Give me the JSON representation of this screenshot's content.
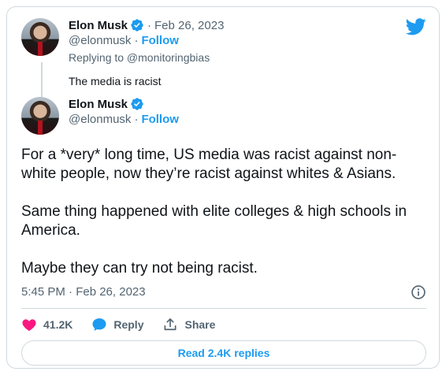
{
  "reply_to_tweet": {
    "author_name": "Elon Musk",
    "date": "Feb 26, 2023",
    "handle": "@elonmusk",
    "follow_label": "Follow",
    "replying_to": "Replying to @monitoringbias",
    "text": "The media is racist"
  },
  "main_tweet": {
    "author_name": "Elon Musk",
    "handle": "@elonmusk",
    "follow_label": "Follow",
    "paragraphs": [
      "For a *very* long time, US media was racist against non-white people, now they’re racist against whites & Asians.",
      "Same thing happened with elite colleges & high schools in America.",
      "Maybe they can try not being racist."
    ],
    "timestamp": "5:45 PM · Feb 26, 2023"
  },
  "actions": {
    "like_count": "41.2K",
    "reply_label": "Reply",
    "share_label": "Share"
  },
  "read_replies_label": "Read 2.4K replies",
  "icons": {
    "brand": "twitter-bird-icon",
    "verified": "verified-badge-icon",
    "like": "heart-icon",
    "reply": "speech-bubble-icon",
    "share": "share-icon",
    "info": "info-icon"
  },
  "colors": {
    "accent": "#1d9bf0",
    "like": "#f91880",
    "muted": "#536471",
    "border": "#cfd9de"
  }
}
